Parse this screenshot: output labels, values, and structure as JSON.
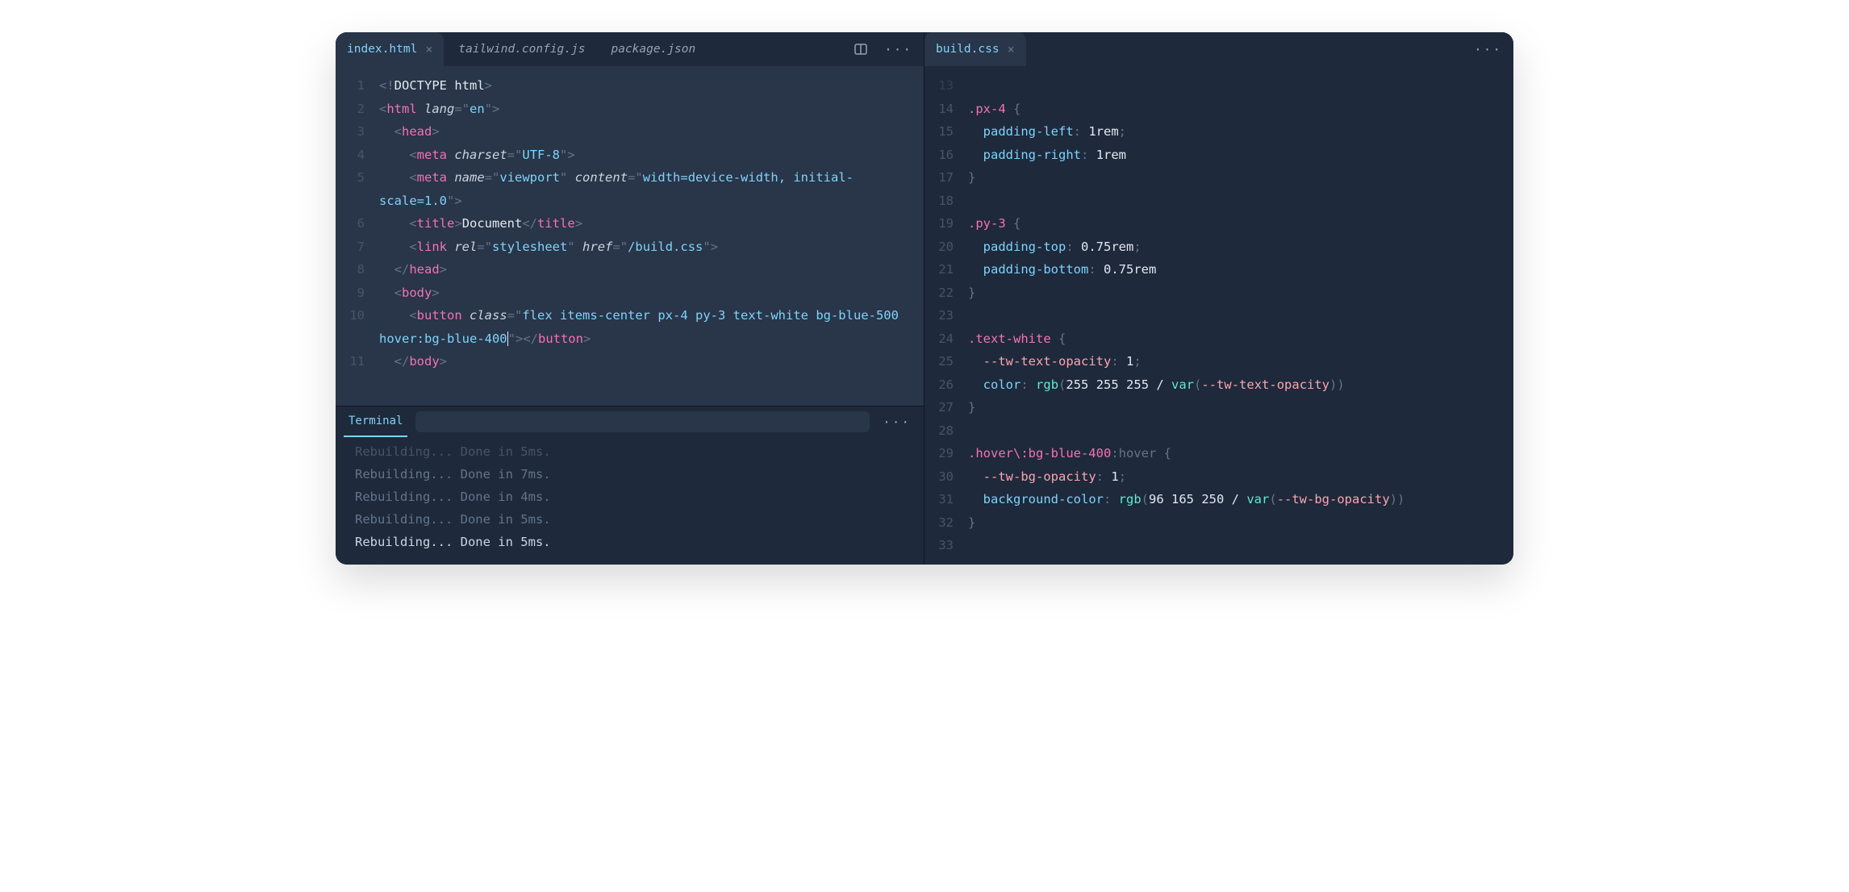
{
  "leftPane": {
    "tabs": [
      {
        "label": "index.html",
        "active": true,
        "closable": true
      },
      {
        "label": "tailwind.config.js",
        "active": false,
        "closable": false
      },
      {
        "label": "package.json",
        "active": false,
        "closable": false
      }
    ],
    "lines": [
      {
        "n": "1",
        "tokens": [
          [
            "c-punc",
            "<!"
          ],
          [
            "c-txt",
            "DOCTYPE html"
          ],
          [
            "c-punc",
            ">"
          ]
        ]
      },
      {
        "n": "2",
        "tokens": [
          [
            "c-punc",
            "<"
          ],
          [
            "c-tag",
            "html"
          ],
          [
            "c-txt",
            " "
          ],
          [
            "c-attr",
            "lang"
          ],
          [
            "c-punc",
            "="
          ],
          [
            "c-punc",
            "\""
          ],
          [
            "c-str",
            "en"
          ],
          [
            "c-punc",
            "\""
          ],
          [
            "c-punc",
            ">"
          ]
        ]
      },
      {
        "n": "3",
        "tokens": [
          [
            "c-txt",
            "  "
          ],
          [
            "c-punc",
            "<"
          ],
          [
            "c-tag",
            "head"
          ],
          [
            "c-punc",
            ">"
          ]
        ]
      },
      {
        "n": "4",
        "tokens": [
          [
            "c-txt",
            "    "
          ],
          [
            "c-punc",
            "<"
          ],
          [
            "c-tag",
            "meta"
          ],
          [
            "c-txt",
            " "
          ],
          [
            "c-attr",
            "charset"
          ],
          [
            "c-punc",
            "="
          ],
          [
            "c-punc",
            "\""
          ],
          [
            "c-str",
            "UTF-8"
          ],
          [
            "c-punc",
            "\""
          ],
          [
            "c-punc",
            ">"
          ]
        ]
      },
      {
        "n": "5",
        "tokens": [
          [
            "c-txt",
            "    "
          ],
          [
            "c-punc",
            "<"
          ],
          [
            "c-tag",
            "meta"
          ],
          [
            "c-txt",
            " "
          ],
          [
            "c-attr",
            "name"
          ],
          [
            "c-punc",
            "="
          ],
          [
            "c-punc",
            "\""
          ],
          [
            "c-str",
            "viewport"
          ],
          [
            "c-punc",
            "\""
          ],
          [
            "c-txt",
            " "
          ],
          [
            "c-attr",
            "content"
          ],
          [
            "c-punc",
            "="
          ],
          [
            "c-punc",
            "\""
          ],
          [
            "c-str",
            "width=device-width, initial-scale=1.0"
          ],
          [
            "c-punc",
            "\""
          ],
          [
            "c-punc",
            ">"
          ]
        ]
      },
      {
        "n": "6",
        "tokens": [
          [
            "c-txt",
            "    "
          ],
          [
            "c-punc",
            "<"
          ],
          [
            "c-tag",
            "title"
          ],
          [
            "c-punc",
            ">"
          ],
          [
            "c-txt",
            "Document"
          ],
          [
            "c-punc",
            "</"
          ],
          [
            "c-tag",
            "title"
          ],
          [
            "c-punc",
            ">"
          ]
        ]
      },
      {
        "n": "7",
        "tokens": [
          [
            "c-txt",
            "    "
          ],
          [
            "c-punc",
            "<"
          ],
          [
            "c-tag",
            "link"
          ],
          [
            "c-txt",
            " "
          ],
          [
            "c-attr",
            "rel"
          ],
          [
            "c-punc",
            "="
          ],
          [
            "c-punc",
            "\""
          ],
          [
            "c-str",
            "stylesheet"
          ],
          [
            "c-punc",
            "\""
          ],
          [
            "c-txt",
            " "
          ],
          [
            "c-attr",
            "href"
          ],
          [
            "c-punc",
            "="
          ],
          [
            "c-punc",
            "\""
          ],
          [
            "c-str",
            "/build.css"
          ],
          [
            "c-punc",
            "\""
          ],
          [
            "c-punc",
            ">"
          ]
        ]
      },
      {
        "n": "8",
        "tokens": [
          [
            "c-txt",
            "  "
          ],
          [
            "c-punc",
            "</"
          ],
          [
            "c-tag",
            "head"
          ],
          [
            "c-punc",
            ">"
          ]
        ]
      },
      {
        "n": "9",
        "tokens": [
          [
            "c-txt",
            "  "
          ],
          [
            "c-punc",
            "<"
          ],
          [
            "c-tag",
            "body"
          ],
          [
            "c-punc",
            ">"
          ]
        ]
      },
      {
        "n": "10",
        "tokens": [
          [
            "c-txt",
            "    "
          ],
          [
            "c-punc",
            "<"
          ],
          [
            "c-tag",
            "button"
          ],
          [
            "c-txt",
            " "
          ],
          [
            "c-attr",
            "class"
          ],
          [
            "c-punc",
            "="
          ],
          [
            "c-punc",
            "\""
          ],
          [
            "c-str",
            "flex items-center px-4 py-3 text-white bg-blue-500 hover:bg-blue-400"
          ],
          [
            "cursor-caret",
            ""
          ],
          [
            "c-punc",
            "\""
          ],
          [
            "c-punc",
            "></"
          ],
          [
            "c-tag",
            "button"
          ],
          [
            "c-punc",
            ">"
          ]
        ]
      },
      {
        "n": "11",
        "tokens": [
          [
            "c-txt",
            "  "
          ],
          [
            "c-punc",
            "</"
          ],
          [
            "c-tag",
            "body"
          ],
          [
            "c-punc",
            ">"
          ]
        ]
      }
    ]
  },
  "terminal": {
    "tabLabel": "Terminal",
    "lines": [
      {
        "text": "Rebuilding... Done in 5ms.",
        "cls": "cut"
      },
      {
        "text": "Rebuilding... Done in 7ms.",
        "cls": ""
      },
      {
        "text": "Rebuilding... Done in 4ms.",
        "cls": ""
      },
      {
        "text": "Rebuilding... Done in 5ms.",
        "cls": ""
      },
      {
        "text": "Rebuilding... Done in 5ms.",
        "cls": "bright"
      }
    ]
  },
  "rightPane": {
    "tabs": [
      {
        "label": "build.css",
        "active": true,
        "closable": true
      }
    ],
    "lines": [
      {
        "n": "13",
        "dim": true,
        "tokens": []
      },
      {
        "n": "14",
        "tokens": [
          [
            "c-sel",
            ".px-4"
          ],
          [
            "c-txt",
            " "
          ],
          [
            "c-punc",
            "{"
          ]
        ]
      },
      {
        "n": "15",
        "tokens": [
          [
            "c-txt",
            "  "
          ],
          [
            "c-prop",
            "padding-left"
          ],
          [
            "c-punc",
            ":"
          ],
          [
            "c-txt",
            " "
          ],
          [
            "c-num",
            "1rem"
          ],
          [
            "c-punc",
            ";"
          ]
        ]
      },
      {
        "n": "16",
        "tokens": [
          [
            "c-txt",
            "  "
          ],
          [
            "c-prop",
            "padding-right"
          ],
          [
            "c-punc",
            ":"
          ],
          [
            "c-txt",
            " "
          ],
          [
            "c-num",
            "1rem"
          ]
        ]
      },
      {
        "n": "17",
        "tokens": [
          [
            "c-punc",
            "}"
          ]
        ]
      },
      {
        "n": "18",
        "tokens": []
      },
      {
        "n": "19",
        "tokens": [
          [
            "c-sel",
            ".py-3"
          ],
          [
            "c-txt",
            " "
          ],
          [
            "c-punc",
            "{"
          ]
        ]
      },
      {
        "n": "20",
        "tokens": [
          [
            "c-txt",
            "  "
          ],
          [
            "c-prop",
            "padding-top"
          ],
          [
            "c-punc",
            ":"
          ],
          [
            "c-txt",
            " "
          ],
          [
            "c-num",
            "0.75rem"
          ],
          [
            "c-punc",
            ";"
          ]
        ]
      },
      {
        "n": "21",
        "tokens": [
          [
            "c-txt",
            "  "
          ],
          [
            "c-prop",
            "padding-bottom"
          ],
          [
            "c-punc",
            ":"
          ],
          [
            "c-txt",
            " "
          ],
          [
            "c-num",
            "0.75rem"
          ]
        ]
      },
      {
        "n": "22",
        "tokens": [
          [
            "c-punc",
            "}"
          ]
        ]
      },
      {
        "n": "23",
        "tokens": []
      },
      {
        "n": "24",
        "tokens": [
          [
            "c-sel",
            ".text-white"
          ],
          [
            "c-txt",
            " "
          ],
          [
            "c-punc",
            "{"
          ]
        ]
      },
      {
        "n": "25",
        "tokens": [
          [
            "c-txt",
            "  "
          ],
          [
            "c-var",
            "--tw-text-opacity"
          ],
          [
            "c-punc",
            ":"
          ],
          [
            "c-txt",
            " "
          ],
          [
            "c-num",
            "1"
          ],
          [
            "c-punc",
            ";"
          ]
        ]
      },
      {
        "n": "26",
        "tokens": [
          [
            "c-txt",
            "  "
          ],
          [
            "c-prop",
            "color"
          ],
          [
            "c-punc",
            ":"
          ],
          [
            "c-txt",
            " "
          ],
          [
            "c-func",
            "rgb"
          ],
          [
            "c-punc",
            "("
          ],
          [
            "c-num",
            "255 255 255"
          ],
          [
            "c-txt",
            " / "
          ],
          [
            "c-func",
            "var"
          ],
          [
            "c-punc",
            "("
          ],
          [
            "c-var",
            "--tw-text-opacity"
          ],
          [
            "c-punc",
            "))"
          ]
        ]
      },
      {
        "n": "27",
        "tokens": [
          [
            "c-punc",
            "}"
          ]
        ]
      },
      {
        "n": "28",
        "tokens": []
      },
      {
        "n": "29",
        "tokens": [
          [
            "c-sel",
            ".hover\\:bg-blue-400"
          ],
          [
            "c-punc",
            ":hover"
          ],
          [
            "c-txt",
            " "
          ],
          [
            "c-punc",
            "{"
          ]
        ]
      },
      {
        "n": "30",
        "tokens": [
          [
            "c-txt",
            "  "
          ],
          [
            "c-var",
            "--tw-bg-opacity"
          ],
          [
            "c-punc",
            ":"
          ],
          [
            "c-txt",
            " "
          ],
          [
            "c-num",
            "1"
          ],
          [
            "c-punc",
            ";"
          ]
        ]
      },
      {
        "n": "31",
        "tokens": [
          [
            "c-txt",
            "  "
          ],
          [
            "c-prop",
            "background-color"
          ],
          [
            "c-punc",
            ":"
          ],
          [
            "c-txt",
            " "
          ],
          [
            "c-func",
            "rgb"
          ],
          [
            "c-punc",
            "("
          ],
          [
            "c-num",
            "96 165 250"
          ],
          [
            "c-txt",
            " / "
          ],
          [
            "c-func",
            "var"
          ],
          [
            "c-punc",
            "("
          ],
          [
            "c-var",
            "--tw-bg-opacity"
          ],
          [
            "c-punc",
            "))"
          ]
        ]
      },
      {
        "n": "32",
        "tokens": [
          [
            "c-punc",
            "}"
          ]
        ]
      },
      {
        "n": "33",
        "tokens": []
      }
    ]
  }
}
